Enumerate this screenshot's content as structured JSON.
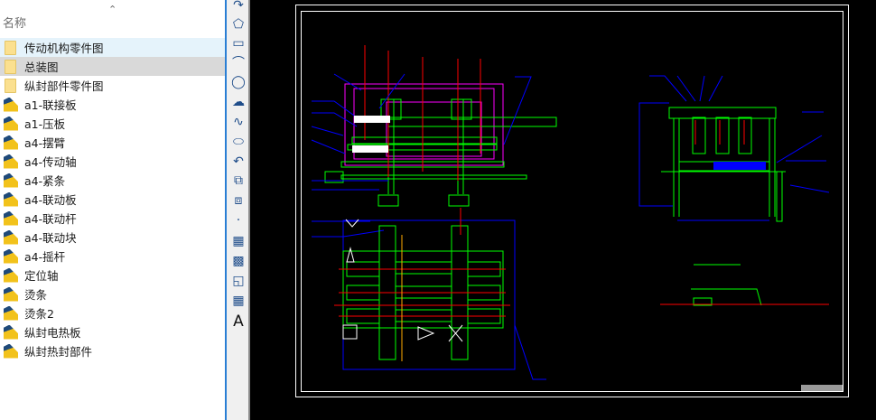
{
  "file_list": {
    "column_header": "名称",
    "items": [
      {
        "label": "传动机构零件图",
        "type": "folder",
        "state": "hover"
      },
      {
        "label": "总装图",
        "type": "folder",
        "state": "selected"
      },
      {
        "label": "纵封部件零件图",
        "type": "folder"
      },
      {
        "label": "a1-联接板",
        "type": "dwg"
      },
      {
        "label": "a1-压板",
        "type": "dwg"
      },
      {
        "label": "a4-摆臂",
        "type": "dwg"
      },
      {
        "label": "a4-传动轴",
        "type": "dwg"
      },
      {
        "label": "a4-紧条",
        "type": "dwg"
      },
      {
        "label": "a4-联动板",
        "type": "dwg"
      },
      {
        "label": "a4-联动杆",
        "type": "dwg"
      },
      {
        "label": "a4-联动块",
        "type": "dwg"
      },
      {
        "label": "a4-摇杆",
        "type": "dwg"
      },
      {
        "label": "定位轴",
        "type": "dwg"
      },
      {
        "label": "烫条",
        "type": "dwg"
      },
      {
        "label": "烫条2",
        "type": "dwg"
      },
      {
        "label": "纵封电热板",
        "type": "dwg"
      },
      {
        "label": "纵封热封部件",
        "type": "dwg"
      }
    ]
  },
  "draw_toolbar": {
    "tools": [
      "polyline-icon",
      "polygon-icon",
      "rectangle-icon",
      "arc-icon",
      "circle-icon",
      "revision-cloud-icon",
      "spline-icon",
      "ellipse-icon",
      "ellipse-arc-icon",
      "insert-block-icon",
      "make-block-icon",
      "point-icon",
      "hatch-icon",
      "gradient-icon",
      "region-icon",
      "table-icon",
      "multiline-text-icon"
    ],
    "text_tool_label": "A"
  },
  "colors": {
    "canvas": "#000000",
    "green": "#00ff00",
    "blue": "#0000ff",
    "red": "#ff0000",
    "magenta": "#ff00ff",
    "accent": "#2a7fd4"
  }
}
